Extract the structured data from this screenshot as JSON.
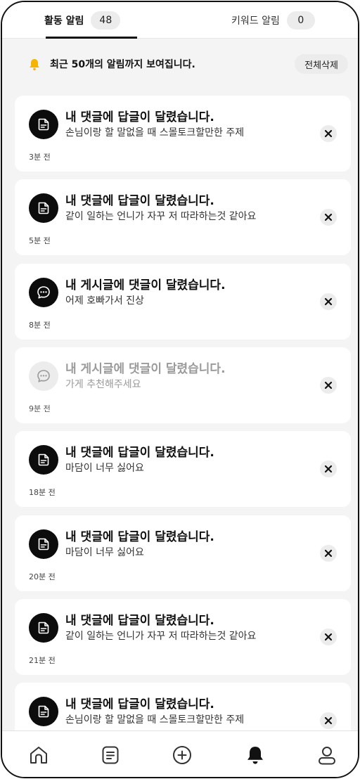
{
  "tabs": {
    "activity": {
      "label": "활동 알림",
      "count": "48"
    },
    "keyword": {
      "label": "키워드 알림",
      "count": "0"
    }
  },
  "notice": {
    "text": "최근 50개의 알림까지 보여집니다.",
    "delete_all_label": "전체삭제",
    "icon": "bell-icon"
  },
  "notifications": [
    {
      "icon": "reply-icon",
      "title": "내 댓글에 답글이 달렸습니다.",
      "body": "손님이랑 할 말없을 때 스몰토크할만한 주제",
      "time": "3분 전",
      "read": false
    },
    {
      "icon": "reply-icon",
      "title": "내 댓글에 답글이 달렸습니다.",
      "body": "같이 일하는 언니가 자꾸 저 따라하는것 같아요",
      "time": "5분 전",
      "read": false
    },
    {
      "icon": "comment-icon",
      "title": "내 게시글에 댓글이 달렸습니다.",
      "body": "어제 호빠가서 진상",
      "time": "8분 전",
      "read": false
    },
    {
      "icon": "comment-icon",
      "title": "내 게시글에 댓글이 달렸습니다.",
      "body": "가게 추천해주세요",
      "time": "9분 전",
      "read": true
    },
    {
      "icon": "reply-icon",
      "title": "내 댓글에 답글이 달렸습니다.",
      "body": "마담이 너무 싫어요",
      "time": "18분 전",
      "read": false
    },
    {
      "icon": "reply-icon",
      "title": "내 댓글에 답글이 달렸습니다.",
      "body": "마담이 너무 싫어요",
      "time": "20분 전",
      "read": false
    },
    {
      "icon": "reply-icon",
      "title": "내 댓글에 답글이 달렸습니다.",
      "body": "같이 일하는 언니가 자꾸 저 따라하는것 같아요",
      "time": "21분 전",
      "read": false
    },
    {
      "icon": "reply-icon",
      "title": "내 댓글에 답글이 달렸습니다.",
      "body": "손님이랑 할 말없을 때 스몰토크할만한 주제",
      "time": "",
      "read": false
    }
  ],
  "bottom_nav": [
    {
      "name": "home-icon",
      "active": false
    },
    {
      "name": "board-icon",
      "active": false
    },
    {
      "name": "add-icon",
      "active": false
    },
    {
      "name": "bell-icon",
      "active": true
    },
    {
      "name": "profile-icon",
      "active": false
    }
  ],
  "colors": {
    "accent": "#111111",
    "card_bg": "#ffffff",
    "page_bg": "#f4f4f5",
    "muted": "#9a9a9a",
    "chip_bg": "#ececec"
  }
}
